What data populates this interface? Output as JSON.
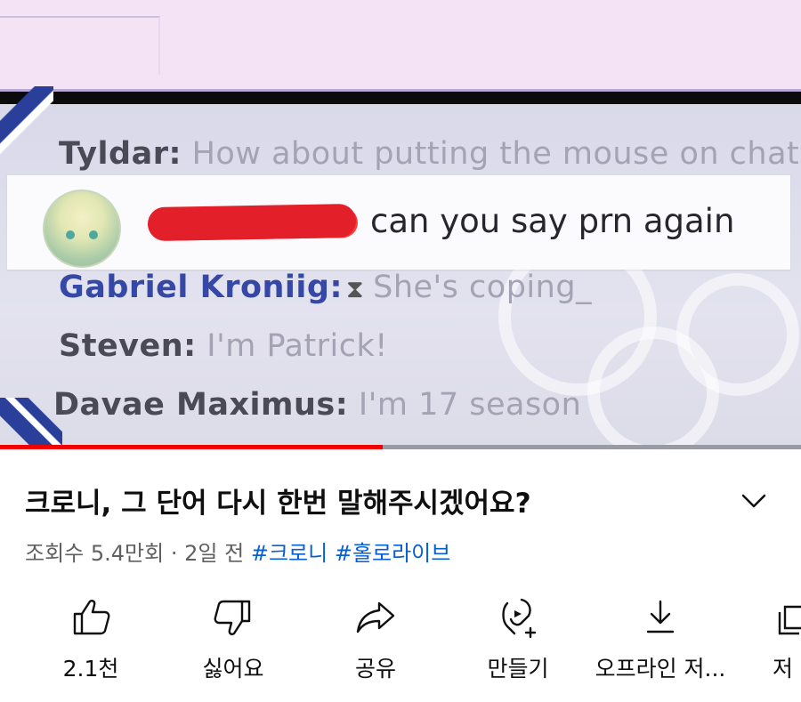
{
  "video": {
    "chat": [
      {
        "name": "Tyldar:",
        "message": "How about putting the mouse on chat"
      },
      {
        "name": "Gabriel Kroniig:",
        "message": "She's coping_"
      },
      {
        "name": "Steven:",
        "message": "I'm Patrick!"
      },
      {
        "name": "Davae Maximus:",
        "message": "I'm 17 season"
      }
    ],
    "highlighted_message": "can you say prn again",
    "progress": 0.478
  },
  "title": "크로니, 그 단어 다시 한번 말해주시겠어요?",
  "meta": {
    "views": "조회수 5.4만회",
    "separator": "·",
    "age": "2일 전",
    "tags": [
      "#크로니",
      "#홀로라이브"
    ]
  },
  "actions": [
    {
      "icon": "thumbs-up-icon",
      "label": "2.1천"
    },
    {
      "icon": "thumbs-down-icon",
      "label": "싫어요"
    },
    {
      "icon": "share-icon",
      "label": "공유"
    },
    {
      "icon": "remix-icon",
      "label": "만들기"
    },
    {
      "icon": "download-icon",
      "label": "오프라인 저..."
    },
    {
      "icon": "save-icon",
      "label": "저"
    }
  ]
}
